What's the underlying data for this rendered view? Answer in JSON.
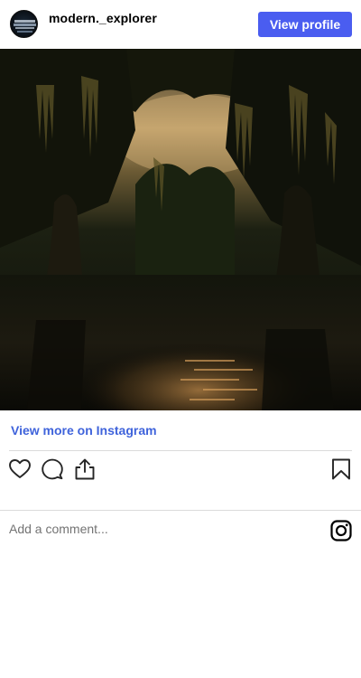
{
  "header": {
    "username": "modern._explorer",
    "view_profile_label": "View profile",
    "avatar_icon": "profile-avatar"
  },
  "post": {
    "image_icon": "swamp-photo",
    "view_more_label": "View more on Instagram"
  },
  "actions": {
    "like_icon": "heart-icon",
    "comment_icon": "comment-icon",
    "share_icon": "share-icon",
    "save_icon": "bookmark-icon"
  },
  "comment": {
    "placeholder": "Add a comment...",
    "brand_icon": "instagram-icon"
  },
  "colors": {
    "accent": "#4a5df0",
    "link": "#3f63db",
    "divider": "#dbdbdb"
  }
}
